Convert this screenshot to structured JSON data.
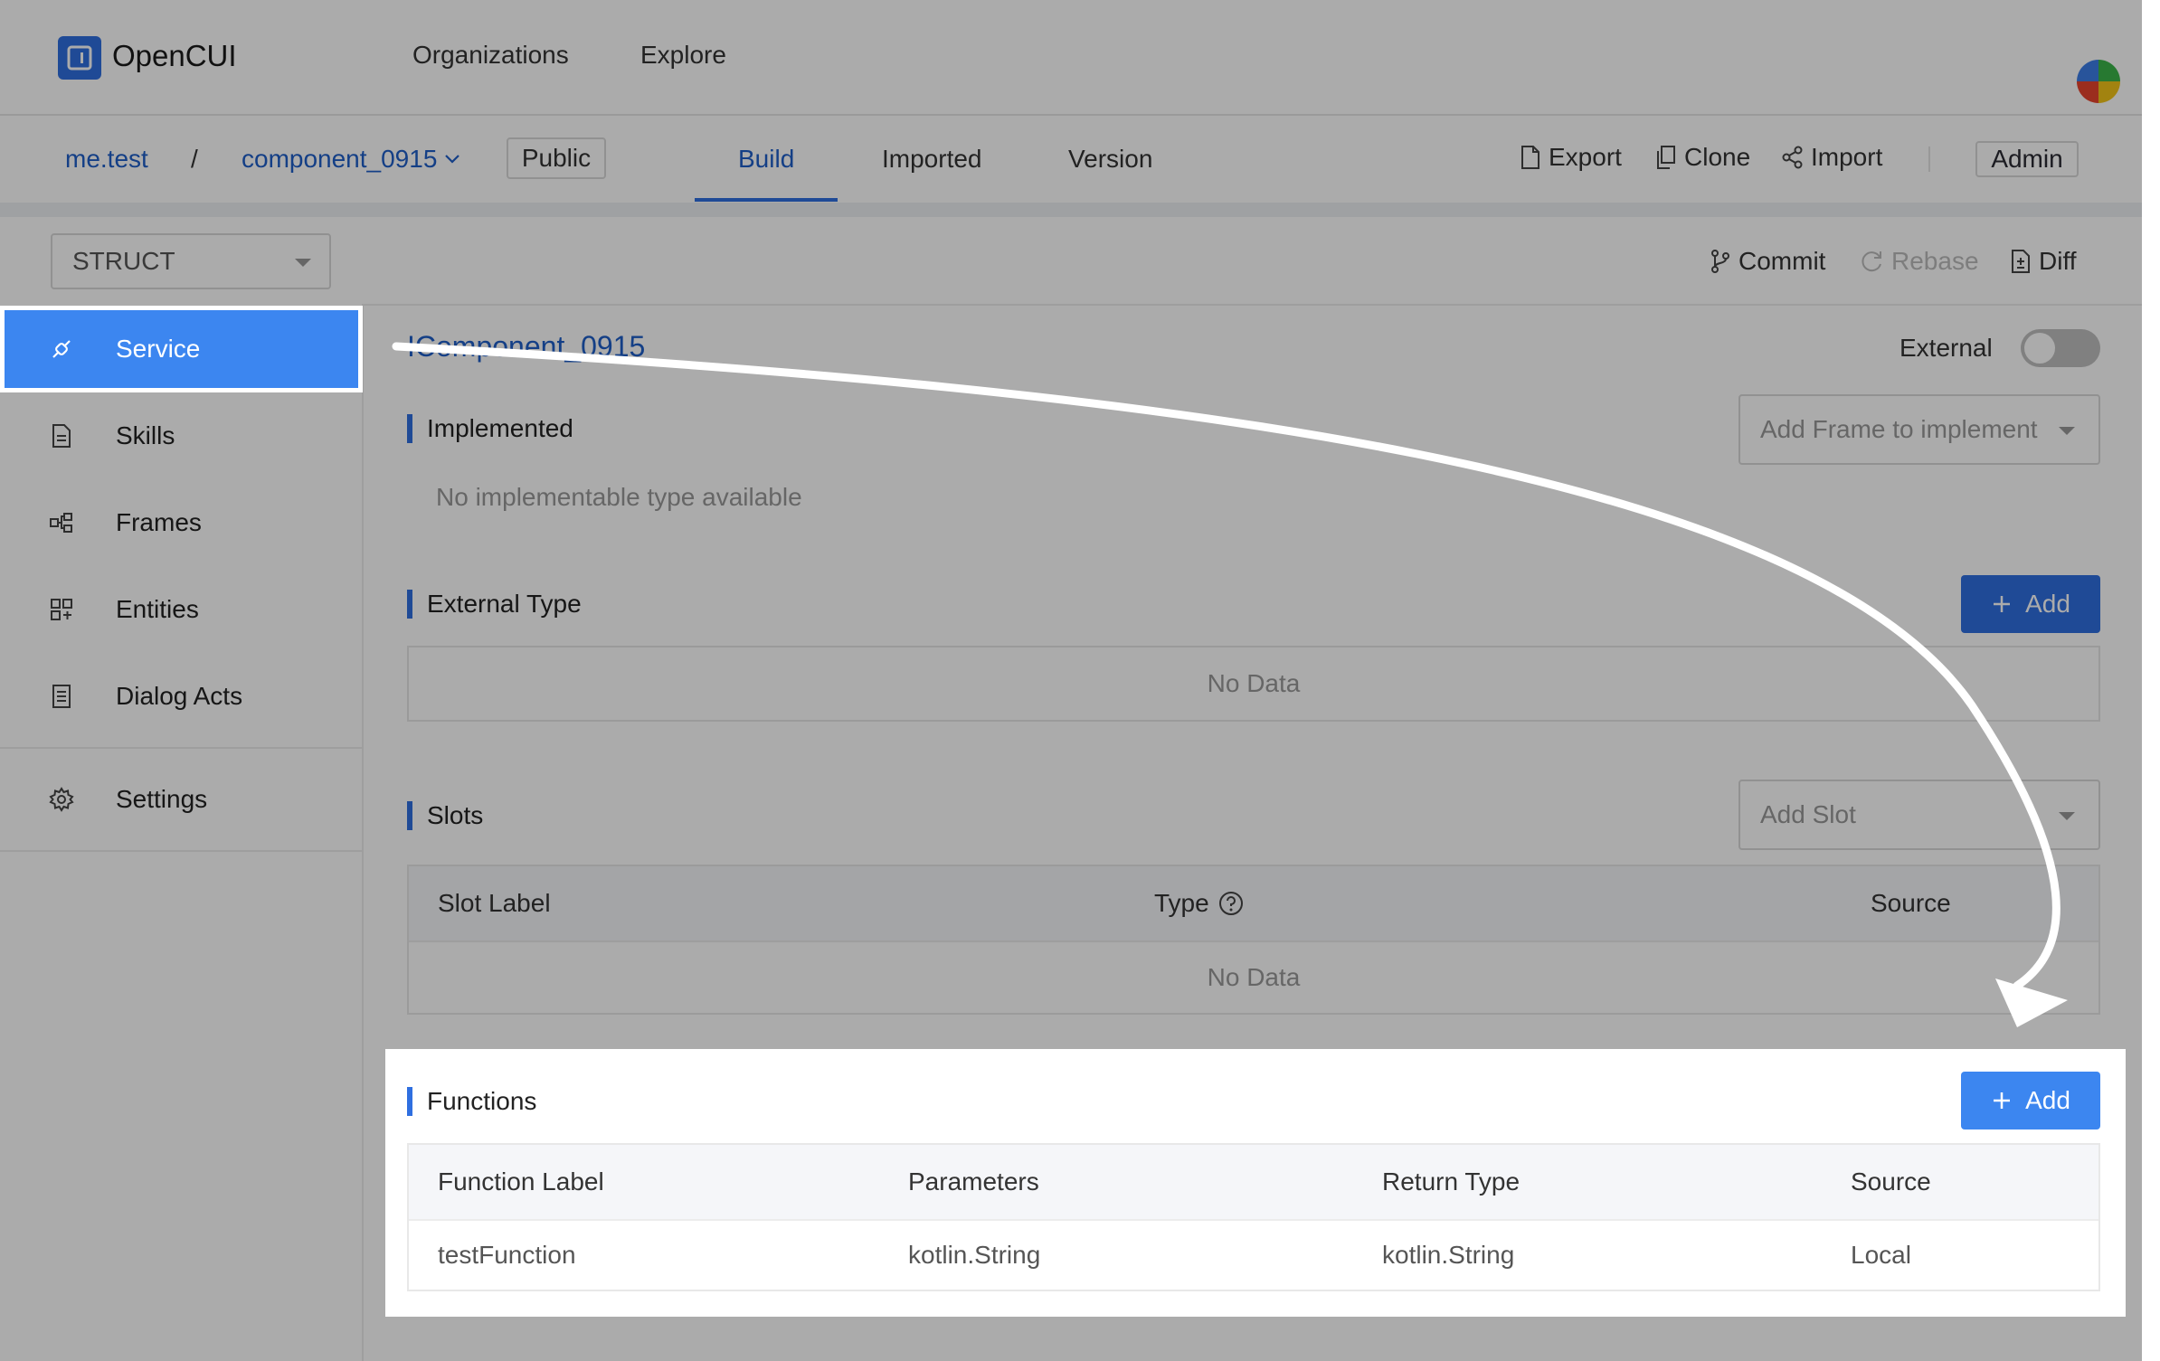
{
  "app": {
    "name": "OpenCUI"
  },
  "topnav": {
    "organizations": "Organizations",
    "explore": "Explore"
  },
  "project": {
    "org": "me.test",
    "separator": "/",
    "name": "component_0915",
    "visibility": "Public"
  },
  "tabs": [
    {
      "label": "Build",
      "active": true
    },
    {
      "label": "Imported",
      "active": false
    },
    {
      "label": "Version",
      "active": false
    }
  ],
  "tools": {
    "export": "Export",
    "clone": "Clone",
    "import": "Import",
    "admin": "Admin"
  },
  "type_select": {
    "value": "STRUCT"
  },
  "vc": {
    "commit": "Commit",
    "rebase": "Rebase",
    "diff": "Diff"
  },
  "sidebar": {
    "items": [
      {
        "label": "Service",
        "icon": "plug-icon",
        "active": true
      },
      {
        "label": "Skills",
        "icon": "document-icon",
        "active": false
      },
      {
        "label": "Frames",
        "icon": "frames-icon",
        "active": false
      },
      {
        "label": "Entities",
        "icon": "grid-icon",
        "active": false
      },
      {
        "label": "Dialog Acts",
        "icon": "list-doc-icon",
        "active": false
      },
      {
        "label": "Settings",
        "icon": "gear-icon",
        "active": false
      }
    ]
  },
  "main": {
    "title": "IComponent_0915",
    "external_label": "External",
    "external_enabled": false,
    "implemented": {
      "title": "Implemented",
      "dropdown_placeholder": "Add Frame to implement",
      "empty_text": "No implementable type available"
    },
    "external_type": {
      "title": "External Type",
      "add_label": "Add",
      "empty_text": "No Data"
    },
    "slots": {
      "title": "Slots",
      "dropdown_placeholder": "Add Slot",
      "columns": [
        "Slot Label",
        "Type",
        "Source"
      ],
      "empty_text": "No Data"
    },
    "functions": {
      "title": "Functions",
      "add_label": "Add",
      "columns": [
        "Function Label",
        "Parameters",
        "Return Type",
        "Source"
      ],
      "rows": [
        [
          "testFunction",
          "kotlin.String",
          "kotlin.String",
          "Local"
        ]
      ]
    }
  },
  "colors": {
    "accent": "#2f6fe0",
    "sidebar_active": "#3c86f0",
    "link": "#1f5ec8"
  }
}
